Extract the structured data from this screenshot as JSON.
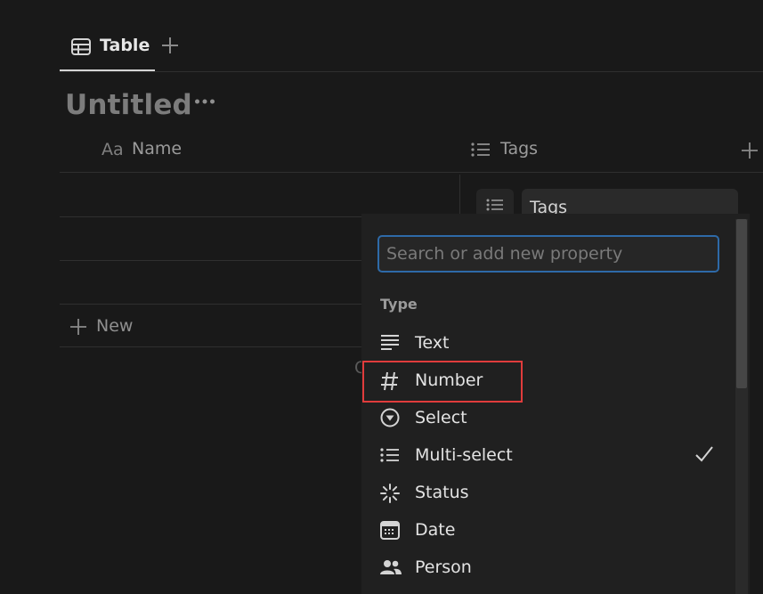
{
  "view_tabs": {
    "active": {
      "label": "Table",
      "icon": "table-icon"
    },
    "add_icon": "plus-icon"
  },
  "page": {
    "title": "Untitled",
    "more_icon": "ellipsis-icon"
  },
  "table": {
    "columns": [
      {
        "label": "Name",
        "icon_text": "Aa"
      },
      {
        "label": "Tags",
        "icon": "list-icon"
      }
    ],
    "add_column_icon": "plus-icon",
    "new_row_label": "New"
  },
  "property_editor": {
    "name_value": "Tags",
    "icon": "list-icon"
  },
  "type_menu": {
    "search_placeholder": "Search or add new property",
    "section_label": "Type",
    "items": [
      {
        "label": "Text",
        "icon": "text-lines-icon"
      },
      {
        "label": "Number",
        "icon": "hash-icon",
        "highlighted": true
      },
      {
        "label": "Select",
        "icon": "select-circle-icon"
      },
      {
        "label": "Multi-select",
        "icon": "list-icon",
        "checked": true
      },
      {
        "label": "Status",
        "icon": "status-spinner-icon"
      },
      {
        "label": "Date",
        "icon": "calendar-icon"
      },
      {
        "label": "Person",
        "icon": "people-icon"
      }
    ]
  },
  "colors": {
    "background": "#191919",
    "menu_background": "#202020",
    "focus_border": "#2e6aa8",
    "highlight_border": "#e03c3c"
  }
}
